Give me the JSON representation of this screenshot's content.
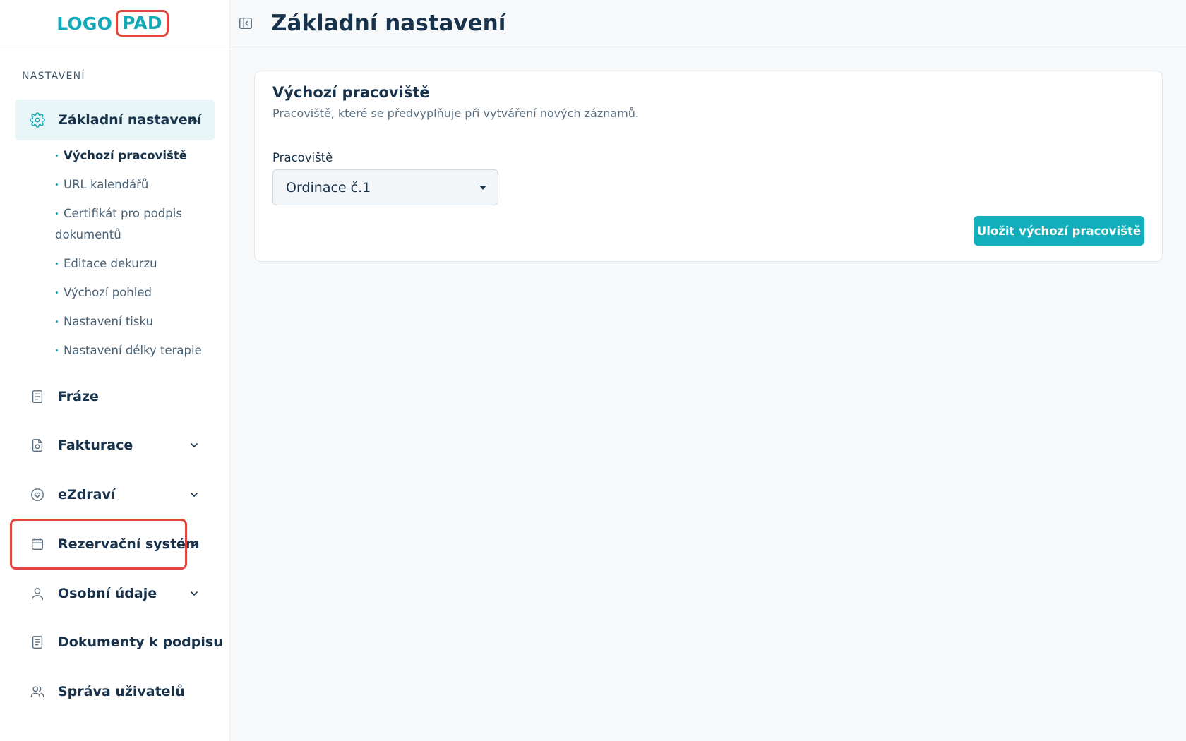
{
  "logo": {
    "main": "LOGO",
    "pad": "PAD"
  },
  "sidebar": {
    "section_heading": "NASTAVENÍ",
    "active_group": {
      "label": "Základní nastavení",
      "icon": "gear-icon",
      "subitems": [
        "Výchozí pracoviště",
        "URL kalendářů",
        "Certifikát pro podpis",
        "dokumentů",
        "Editace dekurzu",
        "Výchozí pohled",
        "Nastavení tisku",
        "Nastavení délky terapie"
      ]
    },
    "items": [
      {
        "label": "Fráze",
        "icon": "document-icon",
        "has_chevron": false
      },
      {
        "label": "Fakturace",
        "icon": "invoice-icon",
        "has_chevron": true
      },
      {
        "label": "eZdraví",
        "icon": "heart-icon",
        "has_chevron": true
      },
      {
        "label": "Rezervační systém",
        "icon": "calendar-icon",
        "has_chevron": true,
        "highlighted": true
      },
      {
        "label": "Osobní údaje",
        "icon": "user-icon",
        "has_chevron": true
      },
      {
        "label": "Dokumenty k podpisu",
        "icon": "document-icon",
        "has_chevron": false
      },
      {
        "label": "Správa uživatelů",
        "icon": "users-icon",
        "has_chevron": false
      }
    ]
  },
  "header": {
    "title": "Základní nastavení"
  },
  "card": {
    "title": "Výchozí pracoviště",
    "subtitle": "Pracoviště, které se předvyplňuje při vytváření nových záznamů.",
    "field_label": "Pracoviště",
    "select_value": "Ordinace č.1",
    "save_label": "Uložit výchozí pracoviště"
  },
  "colors": {
    "accent": "#12aebb",
    "highlight": "#e0463d",
    "text": "#17324a"
  }
}
